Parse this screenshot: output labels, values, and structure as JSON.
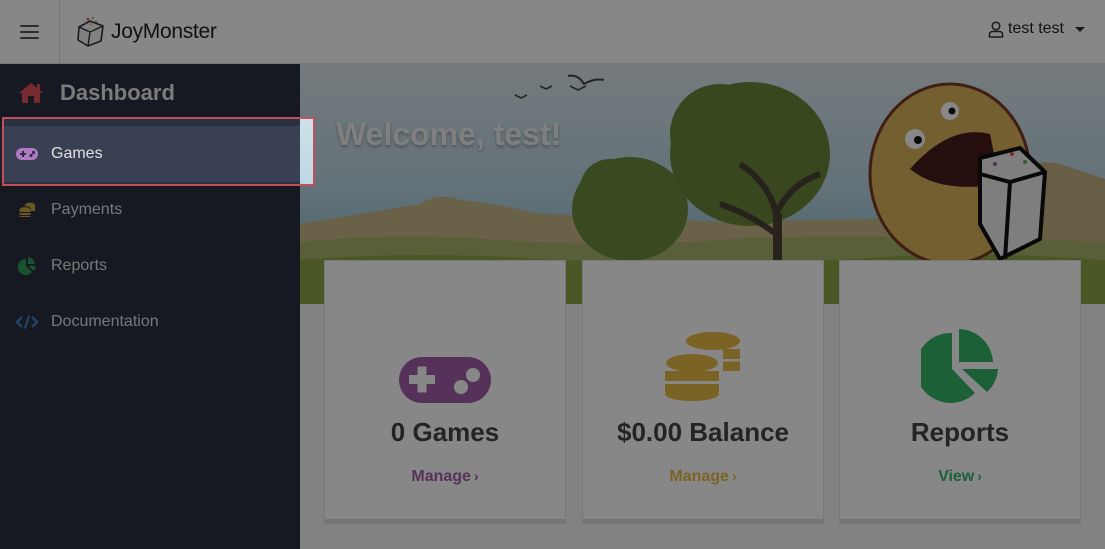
{
  "header": {
    "brand": "JoyMonster",
    "user_name": "test test",
    "icons": {
      "menu": "hamburger-icon",
      "logo": "box-logo-icon",
      "user": "user-icon",
      "caret": "caret-down-icon"
    }
  },
  "sidebar": {
    "dashboard_label": "Dashboard",
    "items": [
      {
        "label": "Games",
        "icon": "gamepad-icon",
        "color": "#b07ac4",
        "active": true
      },
      {
        "label": "Payments",
        "icon": "coins-icon",
        "color": "#c9a640"
      },
      {
        "label": "Reports",
        "icon": "pie-chart-icon",
        "color": "#2e9b59"
      },
      {
        "label": "Documentation",
        "icon": "code-icon",
        "color": "#3f7fc2"
      }
    ]
  },
  "banner": {
    "welcome": "Welcome, test!"
  },
  "cards": [
    {
      "title": "0 Games",
      "link": "Manage",
      "icon": "gamepad-icon",
      "color": "#a25fab"
    },
    {
      "title": "$0.00 Balance",
      "link": "Manage",
      "icon": "coins-icon",
      "color": "#e6bb46"
    },
    {
      "title": "Reports",
      "link": "View",
      "icon": "pie-chart-icon",
      "color": "#35b56b"
    }
  ],
  "tour": {
    "highlighted": "Games",
    "outline_color": "#c0505a"
  }
}
